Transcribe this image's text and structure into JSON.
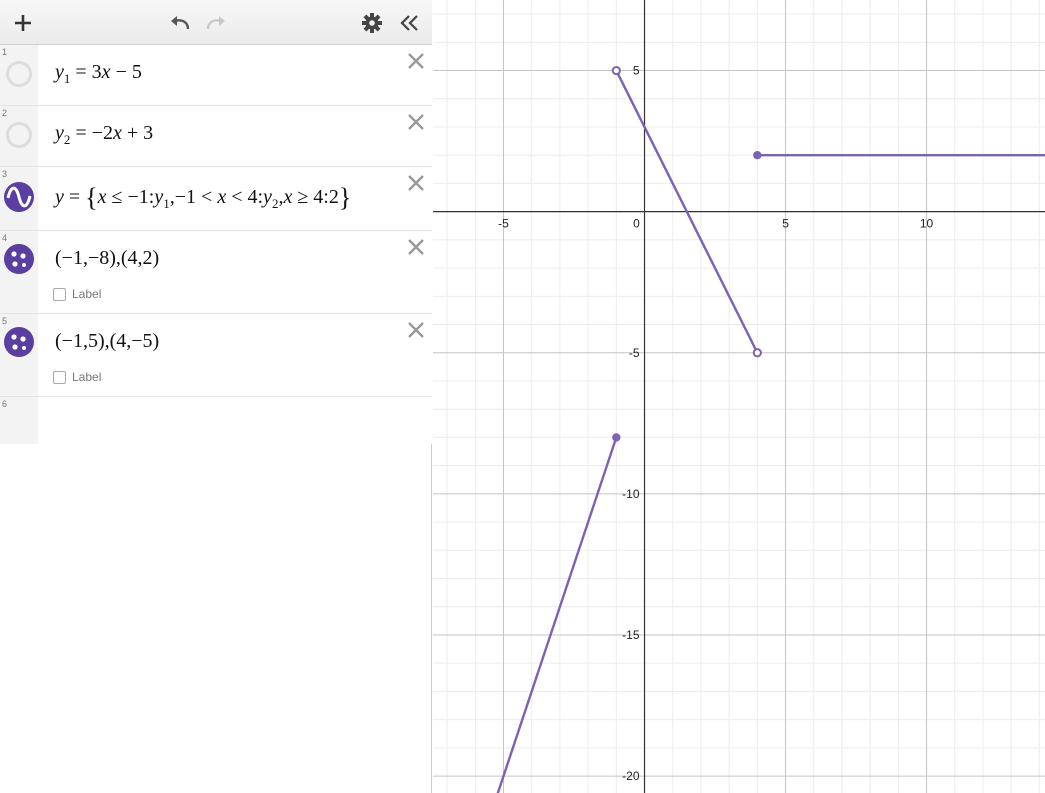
{
  "toolbar": {
    "add_icon": "plus-icon",
    "undo_icon": "undo-icon",
    "redo_icon": "redo-icon",
    "settings_icon": "gear-icon",
    "collapse_icon": "double-chevron-left-icon"
  },
  "expressions": [
    {
      "number": "1",
      "icon": "hidden-circle-icon",
      "latex": "y1 = 3x − 5"
    },
    {
      "number": "2",
      "icon": "hidden-circle-icon",
      "latex": "y2 = −2x + 3"
    },
    {
      "number": "3",
      "icon": "graph-wave-icon",
      "latex": "y = {x ≤ −1:y1,−1 < x < 4:y2,x ≥ 4:2}"
    },
    {
      "number": "4",
      "icon": "point-dots-icon",
      "latex": "(−1,−8),(4,2)",
      "label_text": "Label"
    },
    {
      "number": "5",
      "icon": "point-dots-icon",
      "latex": "(−1,5),(4,−5)",
      "label_text": "Label"
    },
    {
      "number": "6"
    }
  ],
  "graph": {
    "x_ticks": [
      "-5",
      "0",
      "5",
      "10"
    ],
    "y_ticks": [
      "5",
      "-5",
      "-10",
      "-15",
      "-20"
    ],
    "xlim": [
      -7.5,
      14.2
    ],
    "ylim": [
      -20.6,
      7.5
    ],
    "curve_color": "#7b62b3",
    "segments": [
      {
        "from": [
          -5.3,
          -20.9
        ],
        "to": [
          -1,
          -8
        ]
      },
      {
        "from": [
          -1,
          5
        ],
        "to": [
          4,
          -5
        ]
      },
      {
        "from": [
          4,
          2
        ],
        "to": [
          14.2,
          2
        ]
      }
    ],
    "closed_points": [
      [
        -1,
        -8
      ],
      [
        4,
        2
      ]
    ],
    "open_points": [
      [
        -1,
        5
      ],
      [
        4,
        -5
      ]
    ]
  }
}
